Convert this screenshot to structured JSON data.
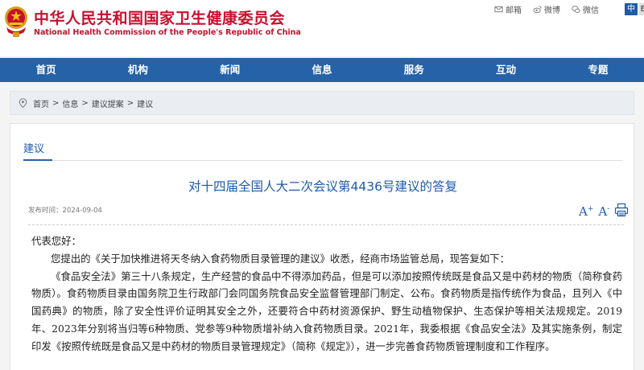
{
  "header": {
    "site_title_cn": "中华人民共和国国家卫生健康委员会",
    "site_title_en": "National Health Commission of the People's Republic of China",
    "top_links": [
      {
        "icon": "mail-icon",
        "label": "邮箱"
      },
      {
        "icon": "weibo-icon",
        "label": "微博"
      },
      {
        "icon": "wechat-icon",
        "label": "微信"
      }
    ],
    "lang_active": "中",
    "lang_inactive": "En"
  },
  "nav": {
    "items": [
      "首页",
      "机构",
      "新闻",
      "信息",
      "服务",
      "互动",
      "专题"
    ]
  },
  "breadcrumb": {
    "items": [
      "首页",
      "信息",
      "建议提案",
      "建议"
    ],
    "separator": ">"
  },
  "section": {
    "title": "建议"
  },
  "article": {
    "title": "对十四届全国人大二次会议第4436号建议的答复",
    "pub_label": "发布时间：",
    "pub_date": "2024-09-04",
    "font_large": "A",
    "font_small": "A",
    "font_large_sign": "+",
    "font_small_sign": "-",
    "print_icon": "print-icon",
    "salutation": "代表您好：",
    "paragraphs": [
      "您提出的《关于加快推进将天冬纳入食药物质目录管理的建议》收悉，经商市场监管总局，现答复如下：",
      "《食品安全法》第三十八条规定，生产经营的食品中不得添加药品，但是可以添加按照传统既是食品又是中药材的物质（简称食药物质）。食药物质目录由国务院卫生行政部门会同国务院食品安全监督管理部门制定、公布。食药物质是指传统作为食品，且列入《中国药典》的物质，除了安全性评价证明其安全之外，还要符合中药材资源保护、野生动植物保护、生态保护等相关法规规定。2019年、2023年分别将当归等6种物质、党参等9种物质增补纳入食药物质目录。2021年，我委根据《食品安全法》及其实施条例，制定印发《按照传统既是食品又是中药材的物质目录管理规定》（简称《规定》），进一步完善食药物质管理制度和工作程序。"
    ]
  },
  "colors": {
    "brand_red": "#c8102e",
    "nav_blue": "#2562a8",
    "link_blue": "#1f5ba8"
  }
}
